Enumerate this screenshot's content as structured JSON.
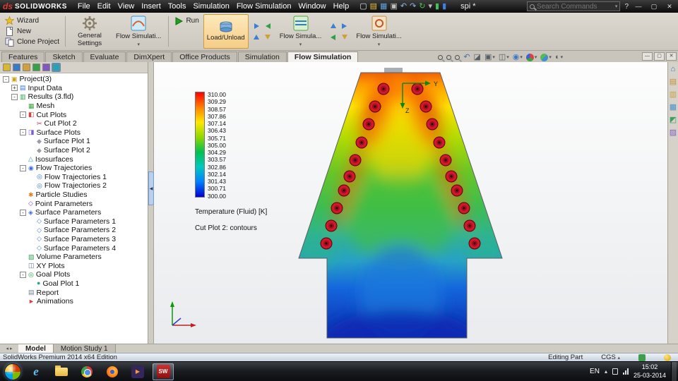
{
  "titlebar": {
    "logo_mark": "ds",
    "logo_text": "SOLIDWORKS",
    "menus": [
      "File",
      "Edit",
      "View",
      "Insert",
      "Tools",
      "Simulation",
      "Flow Simulation",
      "Window",
      "Help"
    ],
    "tool_icons": [
      "new-icon",
      "open-icon",
      "save-icon",
      "print-icon",
      "undo-icon",
      "redo-icon",
      "rebuild-icon",
      "options-icon",
      "simulation-advisor-icon",
      "measure-icon"
    ],
    "doc_name": "spi *",
    "search": {
      "placeholder": "Search Commands"
    },
    "help_label": "?",
    "window_controls": [
      "minimize-icon",
      "restore-icon",
      "close-icon"
    ]
  },
  "ribbon": {
    "wizard": "Wizard",
    "new": "New",
    "clone_project": "Clone Project",
    "general_settings": "General Settings",
    "flow_simulation_features": "Flow Simulati...",
    "run": "Run",
    "load_unload": "Load/Unload",
    "flow_simulation_display": "Flow Simula...",
    "flow_simulation_options": "Flow Simulati..."
  },
  "command_tabs": {
    "items": [
      "Features",
      "Sketch",
      "Evaluate",
      "DimXpert",
      "Office Products",
      "Simulation",
      "Flow Simulation"
    ],
    "active": "Flow Simulation"
  },
  "viewport_toolbar": [
    "zoom-to-fit-icon",
    "zoom-to-area-icon",
    "zoom-in-out-icon",
    "previous-view-icon",
    "section-view-icon",
    "view-orientation-icon",
    "display-style-icon",
    "hide-show-items-icon",
    "edit-appearance-icon",
    "apply-scene-icon",
    "view-settings-icon"
  ],
  "feature_manager": {
    "tabs": [
      "featuremanager-tab-icon",
      "propertymanager-tab-icon",
      "configurationmanager-tab-icon",
      "dimxpertmanager-tab-icon",
      "displaymanager-tab-icon",
      "flow-simulation-tab-icon"
    ],
    "active_tab": "flow-simulation-tab-icon",
    "items": [
      {
        "label": "Project(3)",
        "depth": 0,
        "icon": "project-icon",
        "exp": "minus"
      },
      {
        "label": "Input Data",
        "depth": 1,
        "icon": "input-data-icon",
        "exp": "plus"
      },
      {
        "label": "Results (3.fld)",
        "depth": 1,
        "icon": "results-icon",
        "exp": "minus"
      },
      {
        "label": "Mesh",
        "depth": 2,
        "icon": "mesh-icon"
      },
      {
        "label": "Cut Plots",
        "depth": 2,
        "icon": "cut-plots-icon",
        "exp": "minus"
      },
      {
        "label": "Cut Plot 2",
        "depth": 3,
        "icon": "cut-plot-icon"
      },
      {
        "label": "Surface Plots",
        "depth": 2,
        "icon": "surface-plots-icon",
        "exp": "minus"
      },
      {
        "label": "Surface Plot 1",
        "depth": 3,
        "icon": "surface-plot-icon"
      },
      {
        "label": "Surface Plot 2",
        "depth": 3,
        "icon": "surface-plot-icon"
      },
      {
        "label": "Isosurfaces",
        "depth": 2,
        "icon": "isosurfaces-icon"
      },
      {
        "label": "Flow Trajectories",
        "depth": 2,
        "icon": "flow-trajectories-icon",
        "exp": "minus"
      },
      {
        "label": "Flow Trajectories 1",
        "depth": 3,
        "icon": "flow-trajectory-icon"
      },
      {
        "label": "Flow Trajectories 2",
        "depth": 3,
        "icon": "flow-trajectory-icon"
      },
      {
        "label": "Particle Studies",
        "depth": 2,
        "icon": "particle-studies-icon"
      },
      {
        "label": "Point Parameters",
        "depth": 2,
        "icon": "point-parameters-icon"
      },
      {
        "label": "Surface Parameters",
        "depth": 2,
        "icon": "surface-parameters-icon",
        "exp": "minus"
      },
      {
        "label": "Surface Parameters 1",
        "depth": 3,
        "icon": "surface-parameter-icon"
      },
      {
        "label": "Surface Parameters 2",
        "depth": 3,
        "icon": "surface-parameter-icon"
      },
      {
        "label": "Surface Parameters 3",
        "depth": 3,
        "icon": "surface-parameter-icon"
      },
      {
        "label": "Surface Parameters 4",
        "depth": 3,
        "icon": "surface-parameter-icon"
      },
      {
        "label": "Volume Parameters",
        "depth": 2,
        "icon": "volume-parameters-icon"
      },
      {
        "label": "XY Plots",
        "depth": 2,
        "icon": "xy-plots-icon"
      },
      {
        "label": "Goal Plots",
        "depth": 2,
        "icon": "goal-plots-icon",
        "exp": "minus"
      },
      {
        "label": "Goal Plot 1",
        "depth": 3,
        "icon": "goal-plot-icon"
      },
      {
        "label": "Report",
        "depth": 2,
        "icon": "report-icon"
      },
      {
        "label": "Animations",
        "depth": 2,
        "icon": "animations-icon"
      }
    ]
  },
  "viewport": {
    "legend": {
      "values": [
        "310.00",
        "309.29",
        "308.57",
        "307.86",
        "307.14",
        "306.43",
        "305.71",
        "305.00",
        "304.29",
        "303.57",
        "302.86",
        "302.14",
        "301.43",
        "300.71",
        "300.00"
      ],
      "colors": [
        "#ff0000",
        "#ff8000",
        "#ffe800",
        "#90d800",
        "#00c050",
        "#00c8c0",
        "#0080ff",
        "#0000d0"
      ],
      "title": "Temperature (Fluid) [K]",
      "subtitle": "Cut Plot 2: contours"
    },
    "axis_labels": {
      "y": "Y",
      "z": "Z"
    }
  },
  "right_panel": {
    "icons": [
      "home-icon",
      "design-library-icon",
      "file-explorer-icon",
      "view-palette-icon",
      "appearances-icon",
      "custom-properties-icon"
    ]
  },
  "model_tabs": {
    "items": [
      "Model",
      "Motion Study 1"
    ],
    "active": "Model"
  },
  "statusbar": {
    "left": "SolidWorks Premium 2014 x64 Edition",
    "editing": "Editing Part",
    "units": "CGS",
    "icons": [
      "units-dropdown-icon",
      "tag-icon",
      "help-status-icon"
    ]
  },
  "taskbar": {
    "apps": [
      "start-orb-icon",
      "internet-explorer-icon",
      "explorer-folder-icon",
      "chrome-icon",
      "firefox-icon",
      "media-player-icon",
      "solidworks-icon"
    ],
    "active_app": "solidworks-icon",
    "language": "EN",
    "tray_icons": [
      "hidden-icons-icon",
      "action-center-icon",
      "network-icon"
    ],
    "time": "15:02",
    "date": "25-03-2014"
  }
}
